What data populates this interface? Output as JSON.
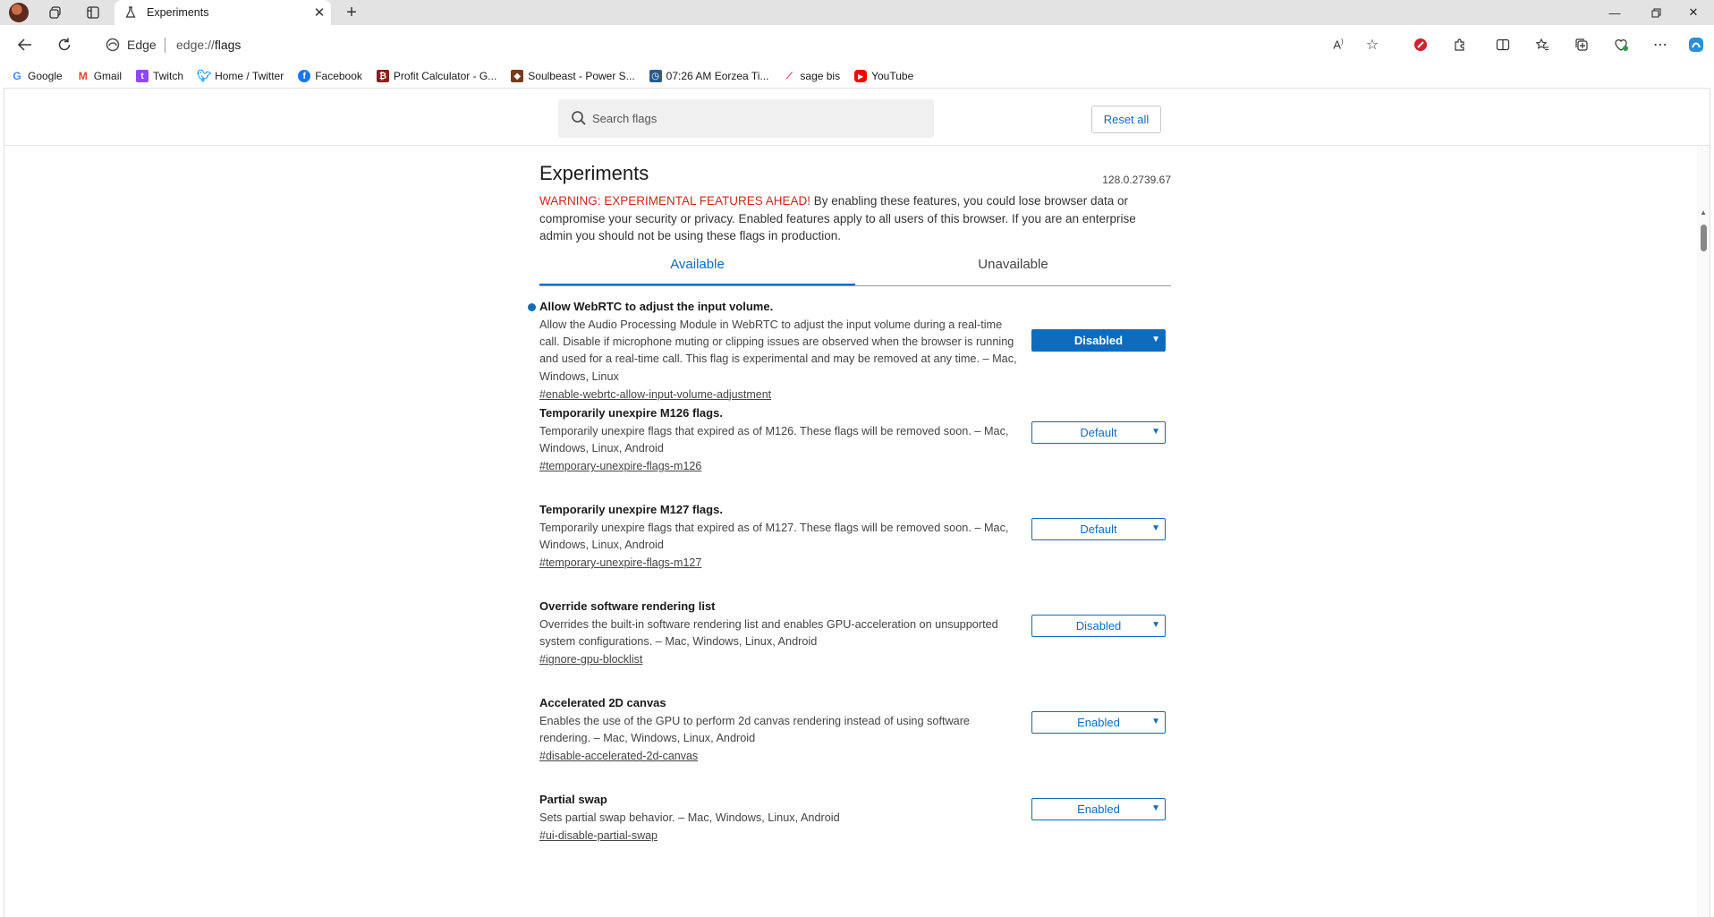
{
  "browser": {
    "tab_title": "Experiments",
    "site_label": "Edge",
    "url_prefix": "edge://",
    "url_path": "flags"
  },
  "favorites": [
    {
      "label": "Google",
      "icon": "google-icon",
      "color": "#4285f4"
    },
    {
      "label": "Gmail",
      "icon": "gmail-icon",
      "color": "#ea4335"
    },
    {
      "label": "Twitch",
      "icon": "twitch-icon",
      "color": "#9146ff"
    },
    {
      "label": "Home / Twitter",
      "icon": "twitter-icon",
      "color": "#1d9bf0"
    },
    {
      "label": "Facebook",
      "icon": "facebook-icon",
      "color": "#1877f2"
    },
    {
      "label": "Profit Calculator - G...",
      "icon": "profit-calculator-icon",
      "color": "#8b1d1d"
    },
    {
      "label": "Soulbeast - Power S...",
      "icon": "soulbeast-icon",
      "color": "#7a3b1a"
    },
    {
      "label": "07:26 AM Eorzea Ti...",
      "icon": "eorzea-time-icon",
      "color": "#2b5b8a"
    },
    {
      "label": "sage bis",
      "icon": "sage-bis-icon",
      "color": "#d03060"
    },
    {
      "label": "YouTube",
      "icon": "youtube-icon",
      "color": "#ff0000"
    }
  ],
  "header": {
    "search_placeholder": "Search flags",
    "reset_label": "Reset all"
  },
  "page": {
    "title": "Experiments",
    "version": "128.0.2739.67",
    "warning_prefix": "WARNING: EXPERIMENTAL FEATURES AHEAD!",
    "warning_text": " By enabling these features, you could lose browser data or compromise your security or privacy. Enabled features apply to all users of this browser. If you are an enterprise admin you should not be using these flags in production.",
    "tabs": [
      "Available",
      "Unavailable"
    ]
  },
  "experiments": [
    {
      "name": "Allow WebRTC to adjust the input volume.",
      "desc": "Allow the Audio Processing Module in WebRTC to adjust the input volume during a real-time call. Disable if microphone muting or clipping issues are observed when the browser is running and used for a real-time call. This flag is experimental and may be removed at any time. – Mac, Windows, Linux",
      "link": "#enable-webrtc-allow-input-volume-adjustment",
      "value": "Disabled"
    },
    {
      "name": "Temporarily unexpire M126 flags.",
      "desc": "Temporarily unexpire flags that expired as of M126. These flags will be removed soon. – Mac, Windows, Linux, Android",
      "link": "#temporary-unexpire-flags-m126",
      "value": "Default"
    },
    {
      "name": "Temporarily unexpire M127 flags.",
      "desc": "Temporarily unexpire flags that expired as of M127. These flags will be removed soon. – Mac, Windows, Linux, Android",
      "link": "#temporary-unexpire-flags-m127",
      "value": "Default"
    },
    {
      "name": "Override software rendering list",
      "desc": "Overrides the built-in software rendering list and enables GPU-acceleration on unsupported system configurations. – Mac, Windows, Linux, Android",
      "link": "#ignore-gpu-blocklist",
      "value": "Disabled"
    },
    {
      "name": "Accelerated 2D canvas",
      "desc": "Enables the use of the GPU to perform 2d canvas rendering instead of using software rendering. – Mac, Windows, Linux, Android",
      "link": "#disable-accelerated-2d-canvas",
      "value": "Enabled"
    },
    {
      "name": "Partial swap",
      "desc": "Sets partial swap behavior. – Mac, Windows, Linux, Android",
      "link": "#ui-disable-partial-swap",
      "value": "Enabled"
    }
  ]
}
